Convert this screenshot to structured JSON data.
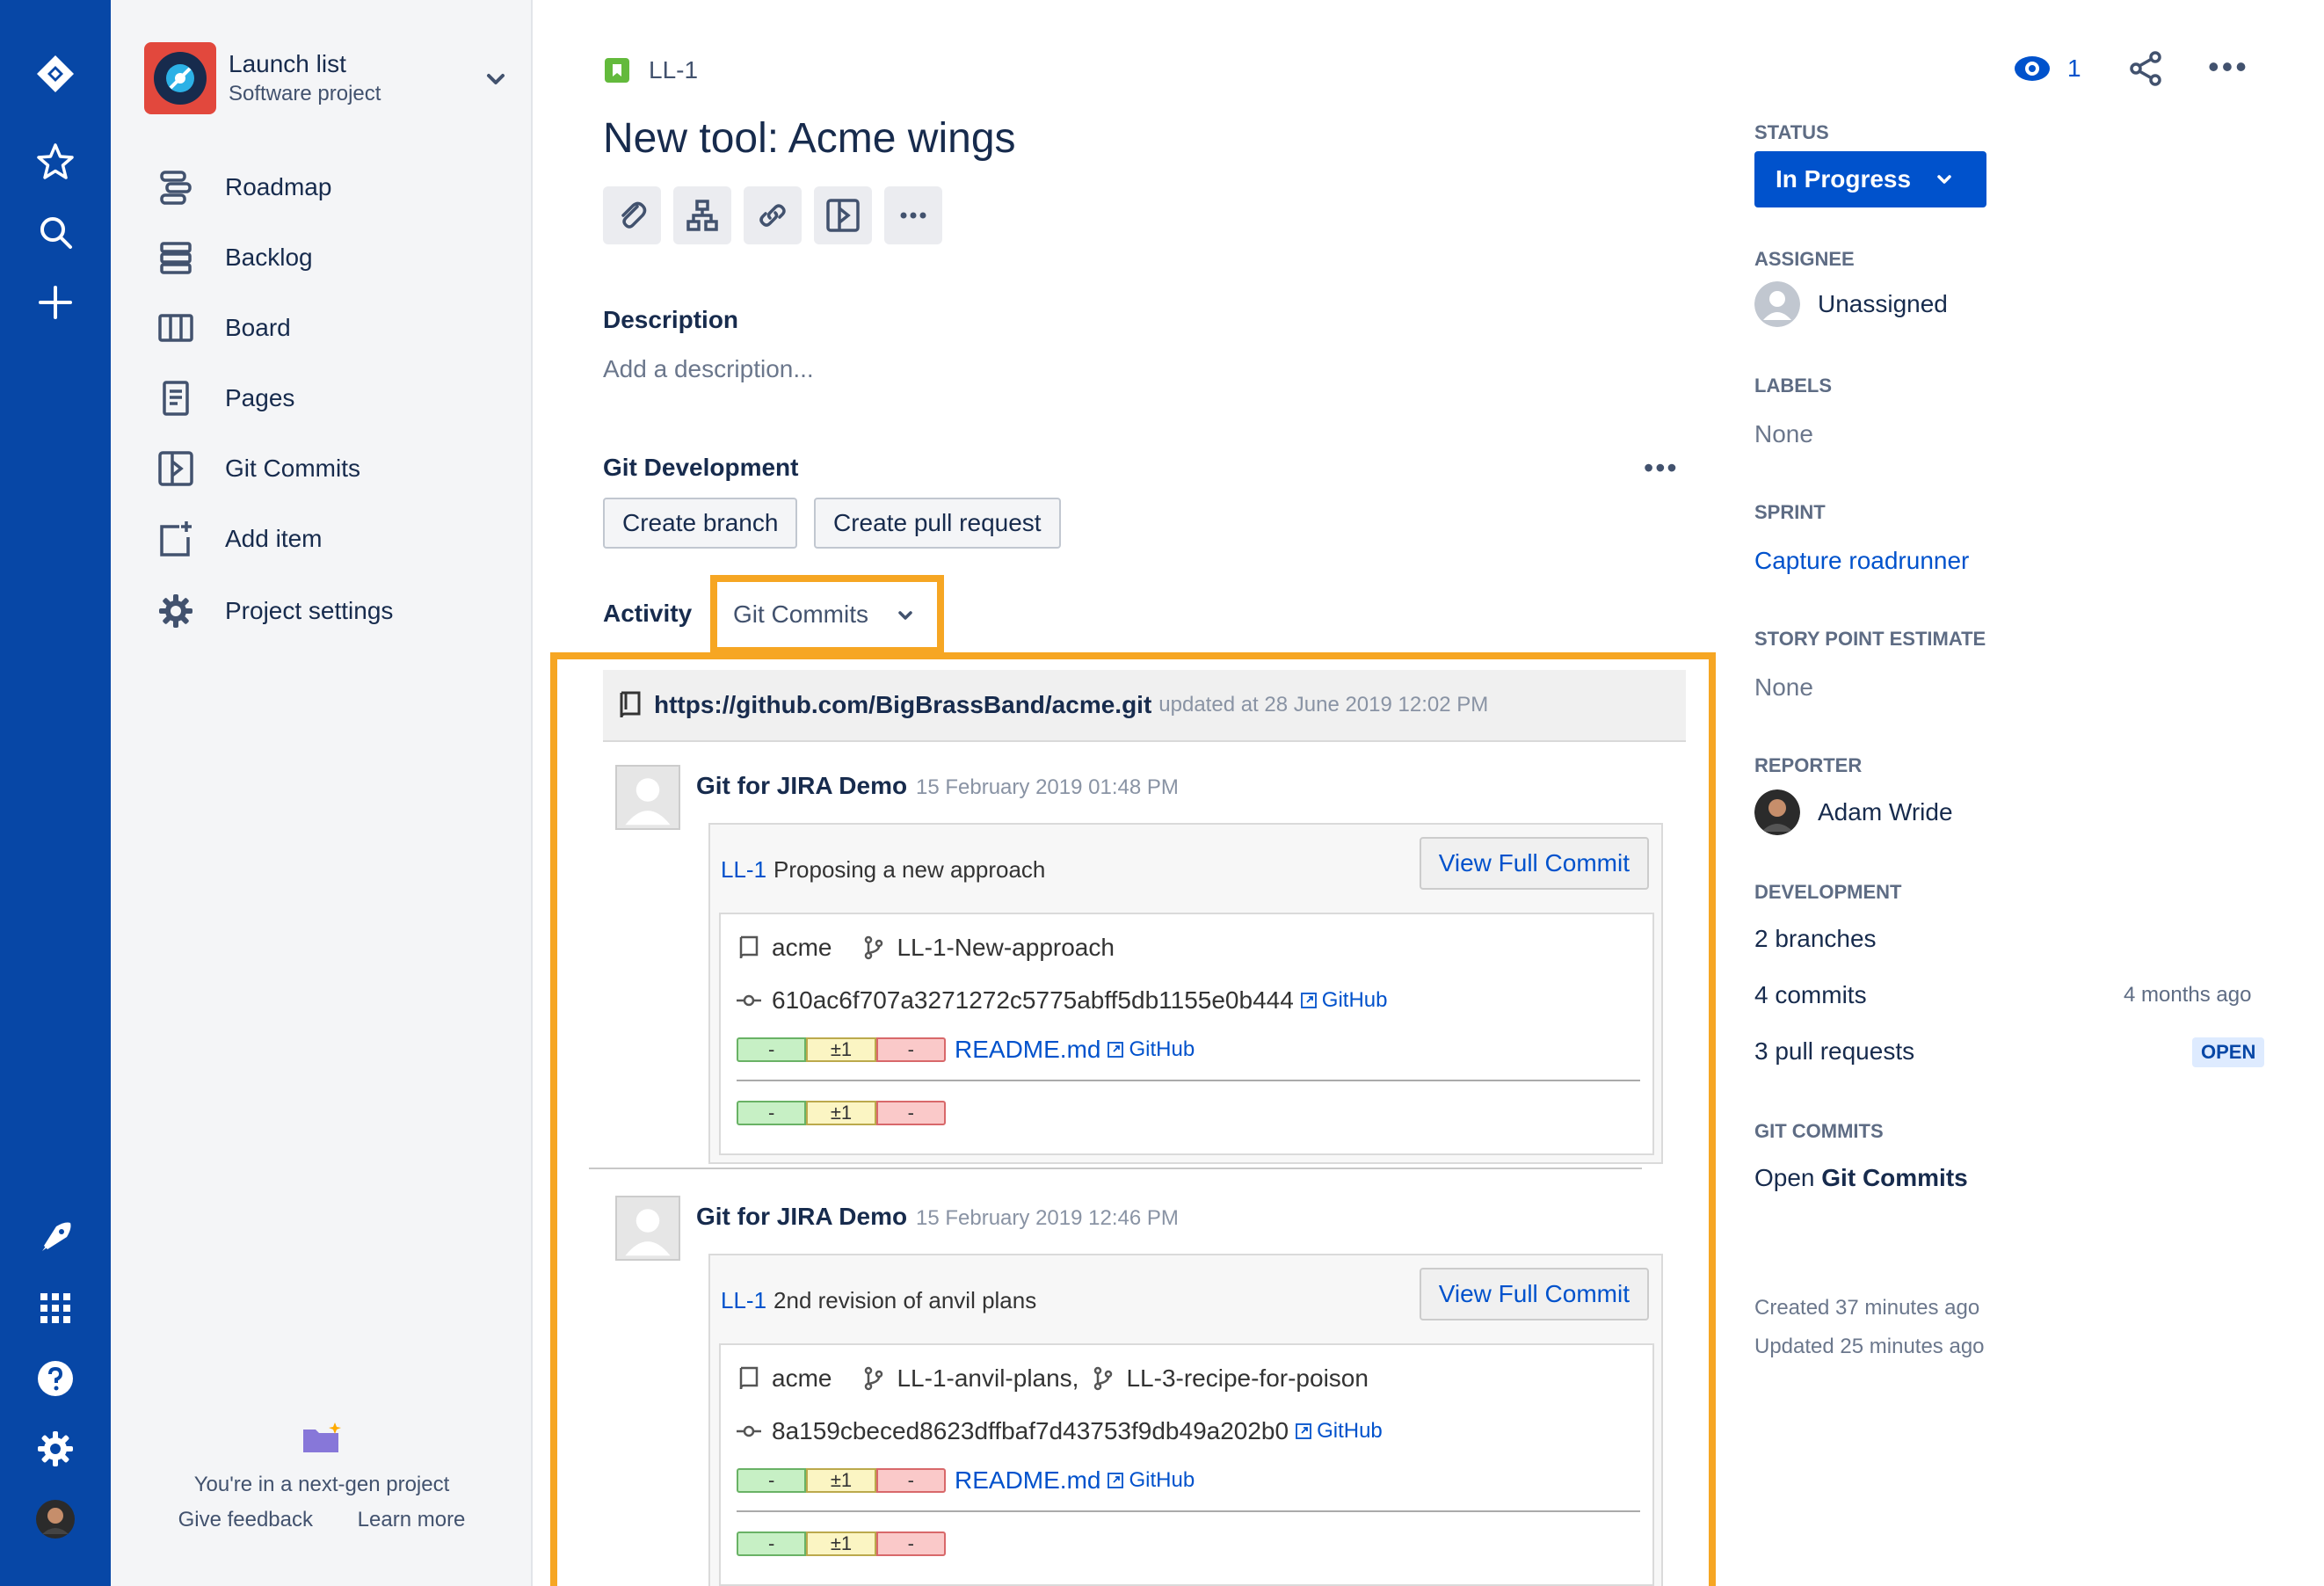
{
  "project": {
    "name": "Launch list",
    "type": "Software project"
  },
  "sidebar": {
    "items": [
      {
        "label": "Roadmap",
        "icon": "roadmap-icon"
      },
      {
        "label": "Backlog",
        "icon": "backlog-icon"
      },
      {
        "label": "Board",
        "icon": "board-icon"
      },
      {
        "label": "Pages",
        "icon": "pages-icon"
      },
      {
        "label": "Git Commits",
        "icon": "git-commits-icon"
      },
      {
        "label": "Add item",
        "icon": "add-item-icon"
      },
      {
        "label": "Project settings",
        "icon": "gear-icon"
      }
    ],
    "nextgen": {
      "title": "You're in a next-gen project",
      "feedback": "Give feedback",
      "learn": "Learn more"
    }
  },
  "issue": {
    "key": "LL-1",
    "title": "New tool: Acme wings",
    "watchers": "1",
    "description_heading": "Description",
    "description_placeholder": "Add a description...",
    "git_dev_heading": "Git Development",
    "create_branch": "Create branch",
    "create_pr": "Create pull request",
    "activity_heading": "Activity",
    "activity_filter": "Git Commits"
  },
  "git": {
    "repo_url": "https://github.com/BigBrassBand/acme.git",
    "repo_updated": "updated at 28 June 2019 12:02 PM",
    "view_full_commit": "View Full Commit",
    "github_label": "GitHub",
    "diff": {
      "added": "-",
      "modified": "±1",
      "deleted": "-"
    },
    "commits": [
      {
        "author": "Git for JIRA Demo",
        "date": "15 February 2019 01:48 PM",
        "issue_link": "LL-1",
        "message": "Proposing a new approach",
        "repo": "acme",
        "branch": "LL-1-New-approach",
        "branch2": "",
        "hash": "610ac6f707a3271272c5775abff5db1155e0b444",
        "file": "README.md"
      },
      {
        "author": "Git for JIRA Demo",
        "date": "15 February 2019 12:46 PM",
        "issue_link": "LL-1",
        "message": "2nd revision of anvil plans",
        "repo": "acme",
        "branch": "LL-1-anvil-plans,",
        "branch2": "LL-3-recipe-for-poison",
        "hash": "8a159cbeced8623dffbaf7d43753f9db49a202b0",
        "file": "README.md"
      }
    ]
  },
  "details": {
    "status_label": "STATUS",
    "status_value": "In Progress",
    "assignee_label": "ASSIGNEE",
    "assignee_value": "Unassigned",
    "labels_label": "LABELS",
    "labels_value": "None",
    "sprint_label": "SPRINT",
    "sprint_value": "Capture roadrunner",
    "estimate_label": "STORY POINT ESTIMATE",
    "estimate_value": "None",
    "reporter_label": "REPORTER",
    "reporter_value": "Adam Wride",
    "development_label": "DEVELOPMENT",
    "branches": "2 branches",
    "commits": "4 commits",
    "commits_time": "4 months ago",
    "pull_requests": "3 pull requests",
    "pr_status": "OPEN",
    "git_commits_label": "GIT COMMITS",
    "open_prefix": "Open",
    "open_git_commits": "Git Commits",
    "created": "Created 37 minutes ago",
    "updated": "Updated 25 minutes ago"
  },
  "colors": {
    "rail": "#0747A6",
    "primary": "#0052CC",
    "highlight": "#F6A623",
    "project_avatar": "#E2483D",
    "story_icon": "#63BA3C"
  }
}
